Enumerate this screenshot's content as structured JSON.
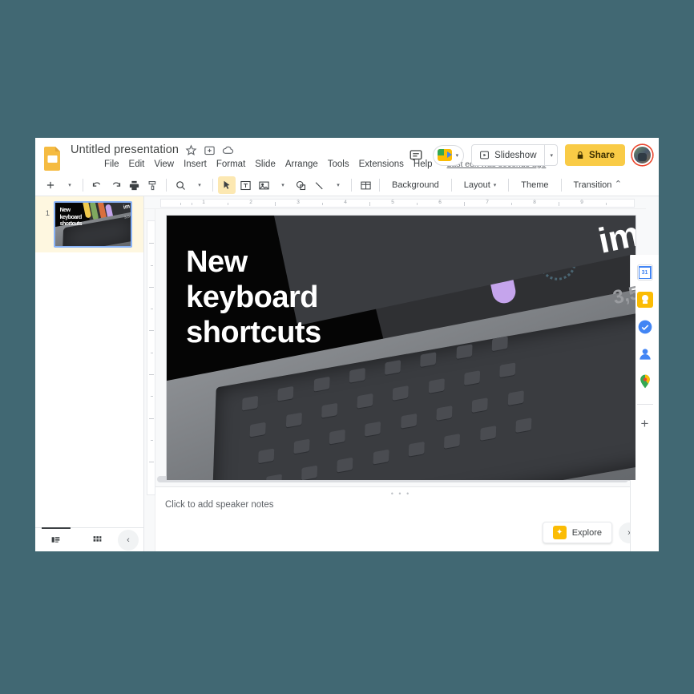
{
  "app": {
    "logo_icon": "google-slides-logo",
    "doc_title": "Untitled presentation",
    "title_icons": [
      {
        "name": "star-icon",
        "glyph": "☆"
      },
      {
        "name": "move-to-folder-icon",
        "glyph": "⊞"
      },
      {
        "name": "cloud-saved-icon",
        "glyph": "☁"
      }
    ],
    "last_edit": "Last edit was seconds ago"
  },
  "menubar": {
    "items": [
      {
        "label": "File"
      },
      {
        "label": "Edit"
      },
      {
        "label": "View"
      },
      {
        "label": "Insert"
      },
      {
        "label": "Format"
      },
      {
        "label": "Slide"
      },
      {
        "label": "Arrange"
      },
      {
        "label": "Tools"
      },
      {
        "label": "Extensions"
      },
      {
        "label": "Help"
      }
    ]
  },
  "header_actions": {
    "comment_icon": "comment-history-icon",
    "meet_icon": "google-meet-icon",
    "meet_caret": "▾",
    "slideshow_icon": "present-icon",
    "slideshow_label": "Slideshow",
    "slideshow_caret": "▾",
    "share_lock_icon": "lock-icon",
    "share_label": "Share",
    "share_color": "#f9cb46",
    "avatar": "user-avatar"
  },
  "toolbar": {
    "new_slide_icon": "plus-icon",
    "new_slide_caret": "▾",
    "undo_icon": "undo-icon",
    "redo_icon": "redo-icon",
    "print_icon": "print-icon",
    "paint_icon": "paint-format-icon",
    "zoom_icon": "zoom-icon",
    "zoom_caret": "▾",
    "cursor_icon": "select-cursor-icon",
    "textbox_icon": "text-box-icon",
    "image_icon": "insert-image-icon",
    "image_caret": "▾",
    "shape_icon": "shape-icon",
    "line_icon": "line-icon",
    "line_caret": "▾",
    "table_icon": "insert-table-icon",
    "background_label": "Background",
    "layout_label": "Layout",
    "layout_caret": "▾",
    "theme_label": "Theme",
    "transition_label": "Transition",
    "collapse_icon": "collapse-toolbar-icon",
    "collapse_glyph": "⌃"
  },
  "filmstrip": {
    "slide_number": "1",
    "view_filmstrip_icon": "filmstrip-view-icon",
    "view_grid_icon": "grid-view-icon",
    "collapse_icon": "collapse-panel-icon",
    "collapse_glyph": "‹"
  },
  "ruler": {
    "ticks": [
      "1",
      "2",
      "3",
      "4",
      "5",
      "6",
      "7",
      "8",
      "9"
    ]
  },
  "slide": {
    "title_line1": "New",
    "title_line2": "keyboard",
    "title_line3": "shortcuts",
    "side_text": "im",
    "stat_text": "3,5",
    "background_color": "#050505",
    "pills": [
      {
        "name": "pill-yellow",
        "color": "#efc94c"
      },
      {
        "name": "pill-green",
        "color": "#7fa85f"
      },
      {
        "name": "pill-orange",
        "color": "#d96f3e"
      },
      {
        "name": "pill-purple",
        "color": "#c5a4ec"
      },
      {
        "name": "pill-white",
        "color": "#f7f3e8"
      }
    ],
    "dotted_shape": "dotted-u-shape",
    "photo": "laptop-keyboard-photo"
  },
  "notes": {
    "placeholder": "Click to add speaker notes",
    "drag_handle": "• • •",
    "explore_label": "Explore",
    "explore_icon": "explore-icon",
    "expand_icon": "expand-notes-icon",
    "expand_glyph": "›"
  },
  "rail": {
    "items": [
      {
        "name": "google-calendar-icon"
      },
      {
        "name": "google-keep-icon"
      },
      {
        "name": "google-tasks-icon"
      },
      {
        "name": "google-contacts-icon"
      },
      {
        "name": "google-maps-icon"
      }
    ],
    "add_on_icon": "add-ons-plus-icon",
    "add_on_glyph": "+"
  }
}
